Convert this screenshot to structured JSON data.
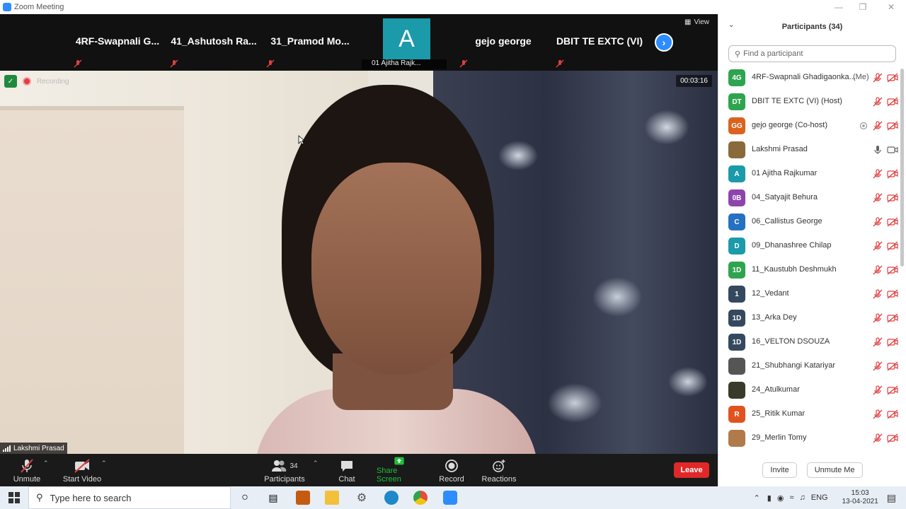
{
  "window": {
    "title": "Zoom Meeting"
  },
  "gallery_strip": {
    "tiles": [
      {
        "name": "4RF-Swapnali G..."
      },
      {
        "name": "41_Ashutosh Ra..."
      },
      {
        "name": "31_Pramod Mo..."
      },
      {
        "name": "gejo george"
      },
      {
        "name": "DBIT TE EXTC (VI)"
      }
    ],
    "avatar_tile": {
      "initial": "A",
      "label": "01 Ajitha Rajk..."
    },
    "view_label": "View"
  },
  "main_video": {
    "recording_label": "Recording",
    "timer": "00:03:16",
    "speaker_name": "Lakshmi Prasad"
  },
  "toolbar": {
    "unmute": "Unmute",
    "start_video": "Start Video",
    "participants": "Participants",
    "participants_count": "34",
    "chat": "Chat",
    "share_screen": "Share Screen",
    "record": "Record",
    "reactions": "Reactions",
    "leave": "Leave"
  },
  "participants_panel": {
    "title": "Participants (34)",
    "search_placeholder": "Find a participant",
    "invite": "Invite",
    "unmute_me": "Unmute Me",
    "list": [
      {
        "initials": "4G",
        "name": "4RF-Swapnali Ghadigaonka...",
        "me": "(Me)",
        "color": "#2ea44f"
      },
      {
        "initials": "DT",
        "name": "DBIT TE EXTC (VI) (Host)",
        "color": "#2ea44f"
      },
      {
        "initials": "GG",
        "name": "gejo george (Co-host)",
        "color": "#d9631f"
      },
      {
        "initials": "",
        "name": "Lakshmi Prasad",
        "color": "#8a6a3a"
      },
      {
        "initials": "A",
        "name": "01 Ajitha Rajkumar",
        "color": "#1b9aaa"
      },
      {
        "initials": "0B",
        "name": "04_Satyajit Behura",
        "color": "#8e44ad"
      },
      {
        "initials": "C",
        "name": "06_Callistus George",
        "color": "#2470c2"
      },
      {
        "initials": "D",
        "name": "09_Dhanashree Chilap",
        "color": "#1b9aaa"
      },
      {
        "initials": "1D",
        "name": "11_Kaustubh Deshmukh",
        "color": "#2ea44f"
      },
      {
        "initials": "1",
        "name": "12_Vedant",
        "color": "#34495e"
      },
      {
        "initials": "1D",
        "name": "13_Arka Dey",
        "color": "#34495e"
      },
      {
        "initials": "1D",
        "name": "16_VELTON DSOUZA",
        "color": "#34495e"
      },
      {
        "initials": "",
        "name": "21_Shubhangi Katariyar",
        "color": "#555555"
      },
      {
        "initials": "",
        "name": "24_Atulkumar",
        "color": "#3a3a2a"
      },
      {
        "initials": "R",
        "name": "25_Ritik Kumar",
        "color": "#e0531f"
      },
      {
        "initials": "",
        "name": "29_Merlin Tomy",
        "color": "#b07a4a"
      }
    ]
  },
  "taskbar": {
    "search_placeholder": "Type here to search",
    "language": "ENG",
    "time": "15:03",
    "date": "13-04-2021"
  },
  "colors": {
    "accent": "#2d8cff",
    "leave": "#e02828",
    "share": "#1fbf3a",
    "muted_red": "#e03e3e"
  }
}
